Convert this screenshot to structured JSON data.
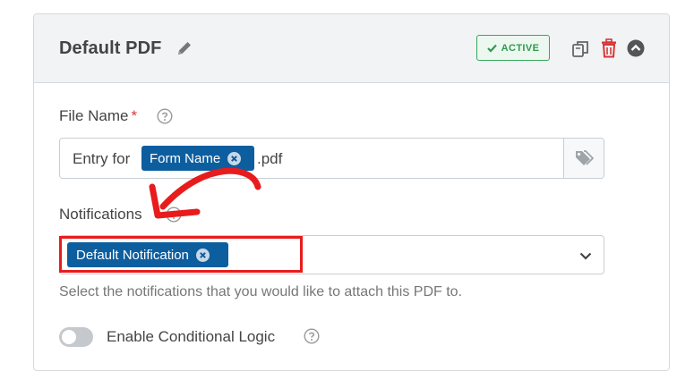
{
  "header": {
    "title": "Default PDF",
    "status": "ACTIVE",
    "icons": [
      "pencil-icon",
      "duplicate-icon",
      "trash-icon",
      "chevron-up-circle-icon"
    ]
  },
  "file_name": {
    "label": "File Name",
    "required_mark": "*",
    "prefix": "Entry for",
    "tag": "Form Name",
    "suffix": ".pdf"
  },
  "notifications": {
    "label": "Notifications",
    "selected": "Default Notification",
    "help": "Select the notifications that you would like to attach this PDF to."
  },
  "conditional_logic": {
    "label": "Enable Conditional Logic",
    "enabled": false
  },
  "colors": {
    "accent": "#0d5e9f",
    "active": "#36a85c",
    "danger": "#d63638",
    "annotation": "#e81c1c"
  }
}
